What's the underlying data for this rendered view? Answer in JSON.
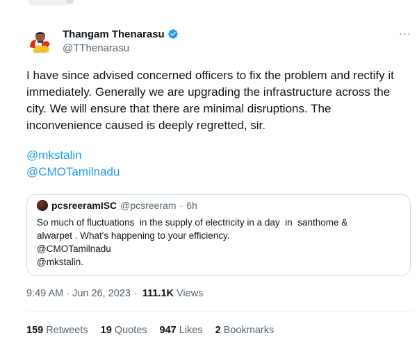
{
  "tweet": {
    "author": {
      "display_name": "Thangam Thenarasu",
      "handle": "@TThenarasu",
      "verified_color": "#1d9bf0"
    },
    "more_label": "···",
    "text": "I have since advised concerned officers to fix the problem and rectify it immediately. Generally we are upgrading the infrastructure across the city. We will ensure that there are minimal disruptions. The inconvenience caused is deeply regretted, sir.",
    "mentions": [
      "@mkstalin",
      "@CMOTamilnadu"
    ],
    "quote": {
      "display_name": "pcsreeramISC",
      "handle": "@pcsreeram",
      "dot": "·",
      "time": "6h",
      "lines": [
        "So much of fluctuations  in the supply of electricity in a day  in  santhome &",
        "alwarpet . What's happening to your efficiency.",
        "@CMOTamilnadu",
        "@mkstalin."
      ]
    },
    "timestamp": "9:49 AM · Jun 26, 2023 · ",
    "views_count": "111.1K",
    "views_label": "Views",
    "stats": [
      {
        "count": "159",
        "label": "Retweets"
      },
      {
        "count": "19",
        "label": "Quotes"
      },
      {
        "count": "947",
        "label": "Likes"
      },
      {
        "count": "2",
        "label": "Bookmarks"
      }
    ]
  },
  "colors": {
    "link": "#1d9bf0",
    "secondary_text": "#536471",
    "primary_text": "#0f1419",
    "border": "#cfd9de"
  }
}
